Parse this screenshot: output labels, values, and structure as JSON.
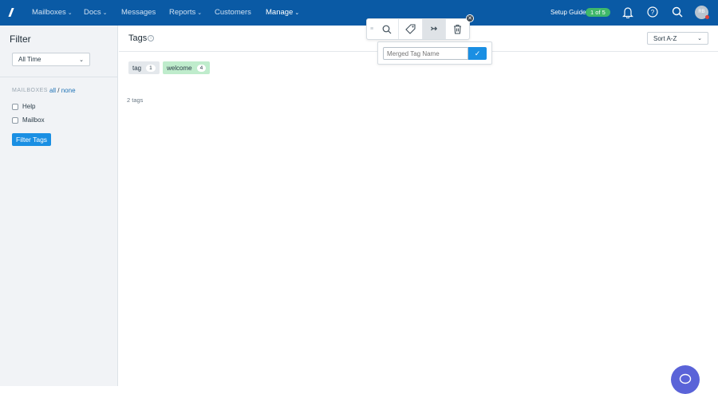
{
  "nav": {
    "items": [
      {
        "label": "Mailboxes",
        "dropdown": true
      },
      {
        "label": "Docs",
        "dropdown": true
      },
      {
        "label": "Messages"
      },
      {
        "label": "Reports",
        "dropdown": true
      },
      {
        "label": "Customers"
      },
      {
        "label": "Manage",
        "dropdown": true,
        "active": true
      }
    ],
    "setup_guide": "Setup Guide",
    "setup_progress": "1 of 5",
    "avatar_initials": "RB"
  },
  "sidebar": {
    "title": "Filter",
    "time_select": "All Time",
    "mailboxes_label": "MAILBOXES",
    "all": "all",
    "sep": "/",
    "none": "none",
    "mailboxes": [
      {
        "label": "Help",
        "checked": false
      },
      {
        "label": "Mailbox",
        "checked": false
      }
    ],
    "filter_button": "Filter Tags"
  },
  "main": {
    "title": "Tags",
    "sort": "Sort A-Z",
    "tags": [
      {
        "name": "tag",
        "count": "1",
        "color": "#e4e8ec"
      },
      {
        "name": "welcome",
        "count": "4",
        "color": "#bfeccc"
      }
    ],
    "count_text": "2 tags"
  },
  "merge": {
    "placeholder": "Merged Tag Name"
  },
  "colors": {
    "nav": "#0a5aa5",
    "accent": "#1a8fe3",
    "badge": "#3fb86a",
    "chat": "#5a63d8"
  }
}
